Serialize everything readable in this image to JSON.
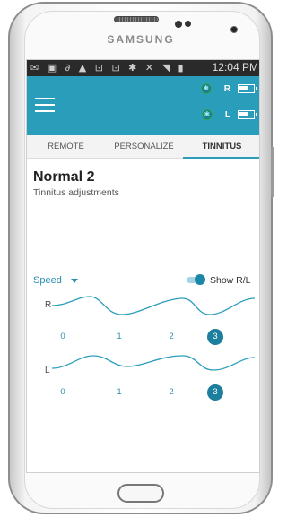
{
  "device": {
    "brand": "SAMSUNG"
  },
  "status_bar": {
    "time": "12:04 PM"
  },
  "app_bar": {
    "right_label": "R",
    "left_label": "L",
    "right_battery_level": 0.7,
    "left_battery_level": 0.7
  },
  "tabs": [
    {
      "label": "REMOTE",
      "active": false
    },
    {
      "label": "PERSONALIZE",
      "active": false
    },
    {
      "label": "TINNITUS",
      "active": true
    }
  ],
  "program": {
    "title": "Normal 2",
    "subtitle": "Tinnitus adjustments"
  },
  "controls": {
    "speed_label": "Speed",
    "toggle_label": "Show R/L",
    "toggle_on": true
  },
  "channels": [
    {
      "label": "R",
      "steps": [
        "0",
        "1",
        "2",
        "3"
      ],
      "selected": 3
    },
    {
      "label": "L",
      "steps": [
        "0",
        "1",
        "2",
        "3"
      ],
      "selected": 3
    }
  ],
  "colors": {
    "accent": "#2a9dbb",
    "selected_step": "#1d7f9e",
    "status_bar": "#2a2a2a"
  }
}
